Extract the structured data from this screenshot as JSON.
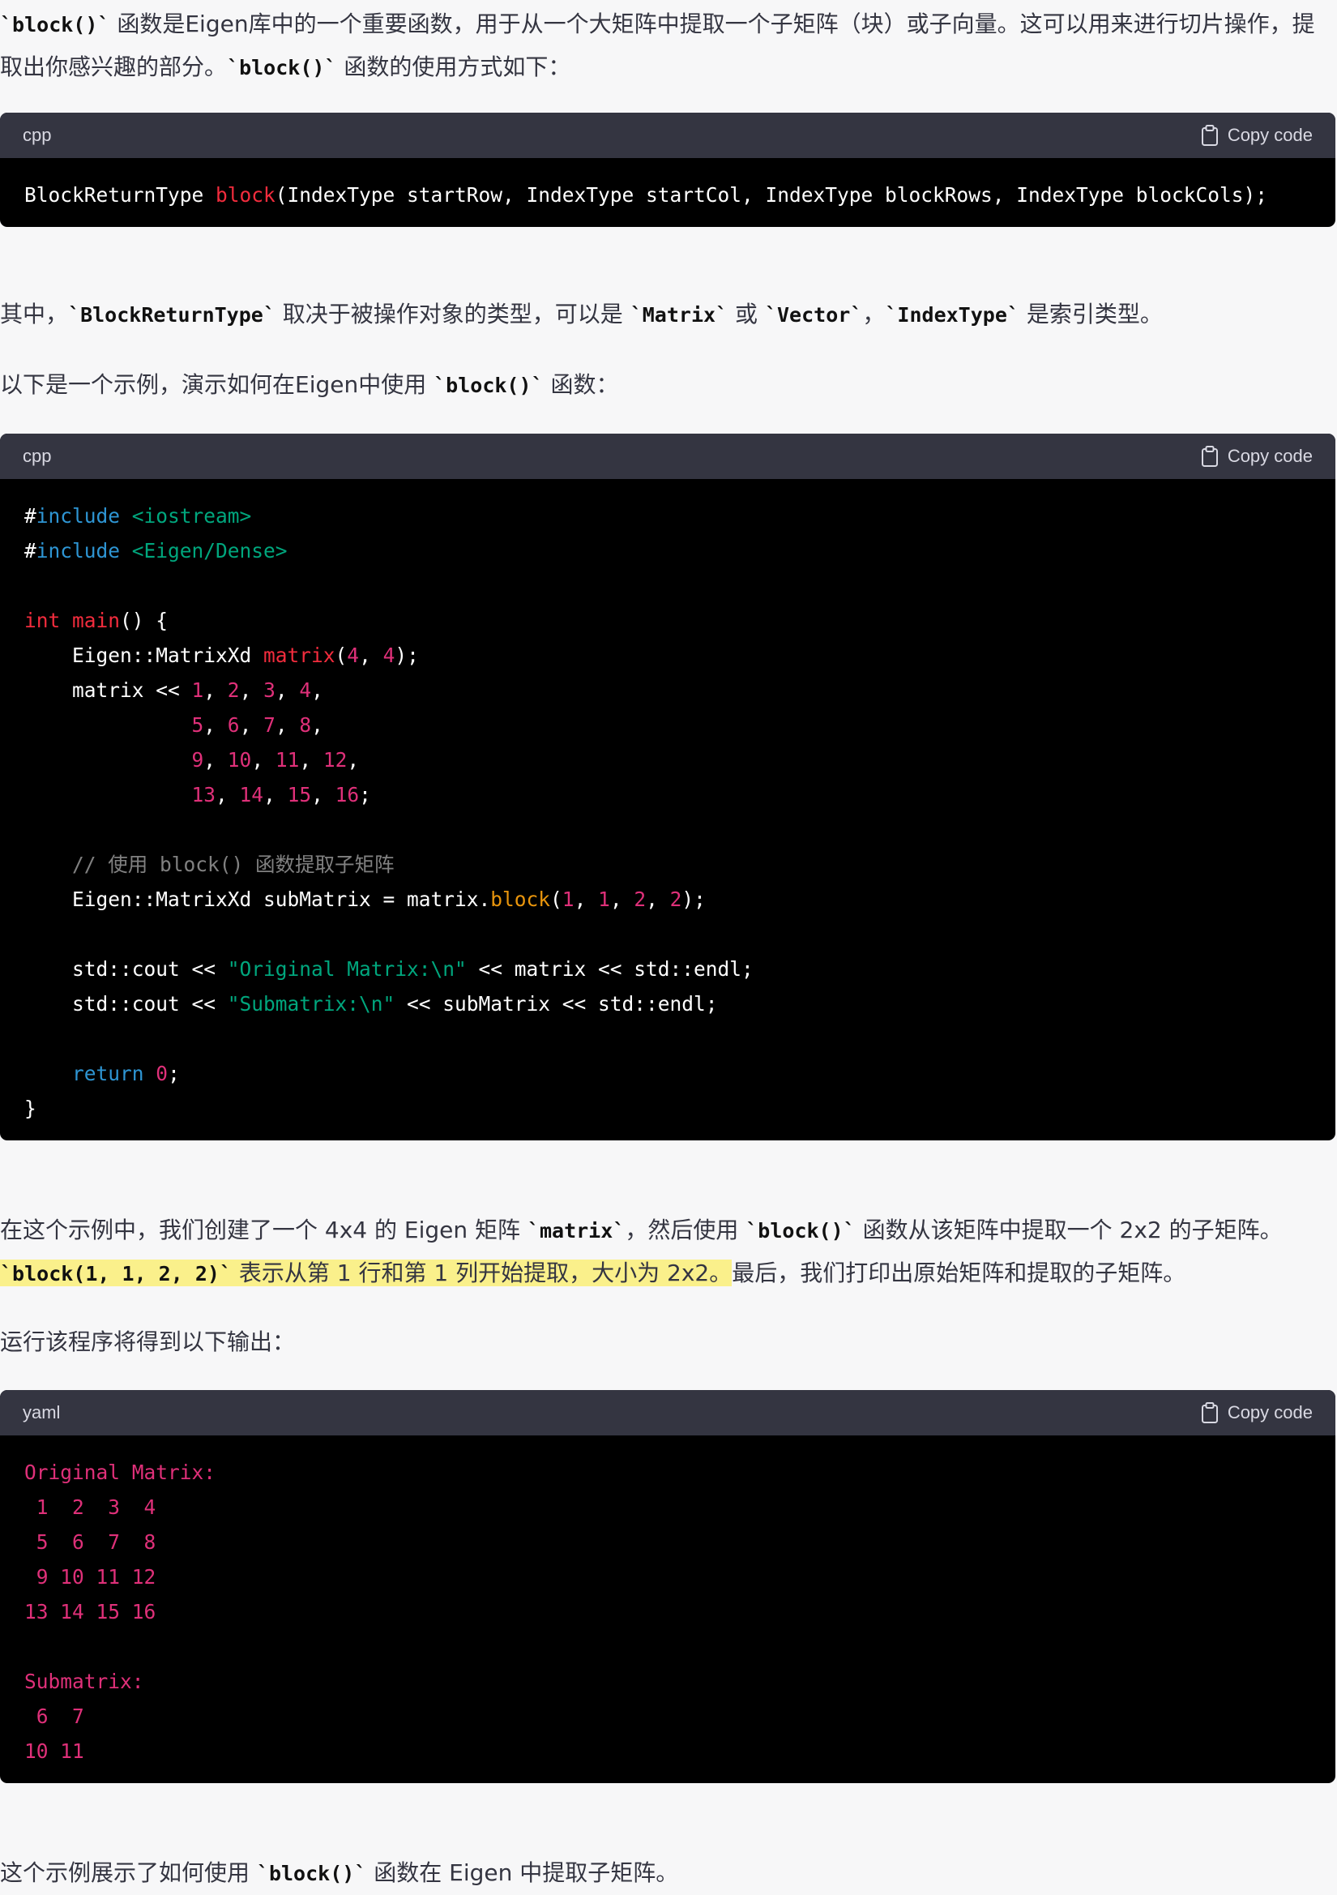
{
  "colors": {
    "page_background": "#f7f7f8",
    "text": "#343541",
    "code_header": "#343541",
    "code_background": "#000000",
    "highlight": "#faf08b",
    "keyword": "#2e95d3",
    "type_or_function": "#f22c3d",
    "number": "#df3079",
    "string": "#00a67d",
    "method": "#e9950c"
  },
  "intro": {
    "seg1": "`block()`",
    "seg2": " 函数是Eigen库中的一个重要函数，用于从一个大矩阵中提取一个子矩阵（块）或子向量。这可以用来进行切片操作，提取出你感兴趣的部分。",
    "seg3": "`block()`",
    "seg4": " 函数的使用方式如下："
  },
  "code1": {
    "lang": "cpp",
    "copy_label": "Copy code",
    "copy_icon": "clipboard-icon",
    "lines": [
      [
        [
          "default",
          "BlockReturnType "
        ],
        [
          "func",
          "block"
        ],
        [
          "default",
          "(IndexType startRow, IndexType startCol, IndexType blockRows, IndexType blockCols);"
        ]
      ]
    ]
  },
  "explain": {
    "seg1": "其中，",
    "seg2": "`BlockReturnType`",
    "seg3": " 取决于被操作对象的类型，可以是 ",
    "seg4": "`Matrix`",
    "seg5": " 或 ",
    "seg6": "`Vector`",
    "seg7": "，",
    "seg8": "`IndexType`",
    "seg9": " 是索引类型。"
  },
  "example_intro": {
    "seg1": "以下是一个示例，演示如何在Eigen中使用 ",
    "seg2": "`block()`",
    "seg3": " 函数："
  },
  "code2": {
    "lang": "cpp",
    "copy_label": "Copy code",
    "copy_icon": "clipboard-icon",
    "lines": [
      [
        [
          "default",
          "#"
        ],
        [
          "keyword",
          "include"
        ],
        [
          "str",
          " <iostream>"
        ]
      ],
      [
        [
          "default",
          "#"
        ],
        [
          "keyword",
          "include"
        ],
        [
          "str",
          " <Eigen/Dense>"
        ]
      ],
      [],
      [
        [
          "type",
          "int"
        ],
        [
          "default",
          " "
        ],
        [
          "func",
          "main"
        ],
        [
          "default",
          "() {"
        ]
      ],
      [
        [
          "default",
          "    Eigen::MatrixXd "
        ],
        [
          "func",
          "matrix"
        ],
        [
          "default",
          "("
        ],
        [
          "num",
          "4"
        ],
        [
          "default",
          ", "
        ],
        [
          "num",
          "4"
        ],
        [
          "default",
          ");"
        ]
      ],
      [
        [
          "default",
          "    matrix << "
        ],
        [
          "num",
          "1"
        ],
        [
          "default",
          ", "
        ],
        [
          "num",
          "2"
        ],
        [
          "default",
          ", "
        ],
        [
          "num",
          "3"
        ],
        [
          "default",
          ", "
        ],
        [
          "num",
          "4"
        ],
        [
          "default",
          ","
        ]
      ],
      [
        [
          "default",
          "              "
        ],
        [
          "num",
          "5"
        ],
        [
          "default",
          ", "
        ],
        [
          "num",
          "6"
        ],
        [
          "default",
          ", "
        ],
        [
          "num",
          "7"
        ],
        [
          "default",
          ", "
        ],
        [
          "num",
          "8"
        ],
        [
          "default",
          ","
        ]
      ],
      [
        [
          "default",
          "              "
        ],
        [
          "num",
          "9"
        ],
        [
          "default",
          ", "
        ],
        [
          "num",
          "10"
        ],
        [
          "default",
          ", "
        ],
        [
          "num",
          "11"
        ],
        [
          "default",
          ", "
        ],
        [
          "num",
          "12"
        ],
        [
          "default",
          ","
        ]
      ],
      [
        [
          "default",
          "              "
        ],
        [
          "num",
          "13"
        ],
        [
          "default",
          ", "
        ],
        [
          "num",
          "14"
        ],
        [
          "default",
          ", "
        ],
        [
          "num",
          "15"
        ],
        [
          "default",
          ", "
        ],
        [
          "num",
          "16"
        ],
        [
          "default",
          ";"
        ]
      ],
      [],
      [
        [
          "default",
          "    "
        ],
        [
          "comment",
          "// 使用 block() 函数提取子矩阵"
        ]
      ],
      [
        [
          "default",
          "    Eigen::MatrixXd subMatrix = matrix."
        ],
        [
          "method",
          "block"
        ],
        [
          "default",
          "("
        ],
        [
          "num",
          "1"
        ],
        [
          "default",
          ", "
        ],
        [
          "num",
          "1"
        ],
        [
          "default",
          ", "
        ],
        [
          "num",
          "2"
        ],
        [
          "default",
          ", "
        ],
        [
          "num",
          "2"
        ],
        [
          "default",
          ");"
        ]
      ],
      [],
      [
        [
          "default",
          "    std::cout << "
        ],
        [
          "str",
          "\"Original Matrix:\\n\""
        ],
        [
          "default",
          " << matrix << std::endl;"
        ]
      ],
      [
        [
          "default",
          "    std::cout << "
        ],
        [
          "str",
          "\"Submatrix:\\n\""
        ],
        [
          "default",
          " << subMatrix << std::endl;"
        ]
      ],
      [],
      [
        [
          "default",
          "    "
        ],
        [
          "keyword",
          "return"
        ],
        [
          "default",
          " "
        ],
        [
          "num",
          "0"
        ],
        [
          "default",
          ";"
        ]
      ],
      [
        [
          "default",
          "}"
        ]
      ]
    ]
  },
  "desc": {
    "seg1": "在这个示例中，我们创建了一个 4x4 的 Eigen 矩阵 ",
    "seg2": "`matrix`",
    "seg3": "，然后使用 ",
    "seg4": "`block()`",
    "seg5": " 函数从该矩阵中提取一个 2x2 的子矩阵。",
    "seg6": "`block(1, 1, 2, 2)`",
    "seg7": " 表示从第 1 行和第 1 列开始提取，大小为 2x2。",
    "seg8": "最后，我们打印出原始矩阵和提取的子矩阵。"
  },
  "output_intro": "运行该程序将得到以下输出：",
  "code3": {
    "lang": "yaml",
    "copy_label": "Copy code",
    "copy_icon": "clipboard-icon",
    "lines": [
      [
        [
          "out",
          "Original Matrix:"
        ]
      ],
      [
        [
          "out",
          " 1  2  3  4"
        ]
      ],
      [
        [
          "out",
          " 5  6  7  8"
        ]
      ],
      [
        [
          "out",
          " 9 10 11 12"
        ]
      ],
      [
        [
          "out",
          "13 14 15 16"
        ]
      ],
      [],
      [
        [
          "out",
          "Submatrix:"
        ]
      ],
      [
        [
          "out",
          " 6  7"
        ]
      ],
      [
        [
          "out",
          "10 11"
        ]
      ]
    ]
  },
  "conclusion": {
    "seg1": "这个示例展示了如何使用 ",
    "seg2": "`block()`",
    "seg3": " 函数在 Eigen 中提取子矩阵。"
  }
}
